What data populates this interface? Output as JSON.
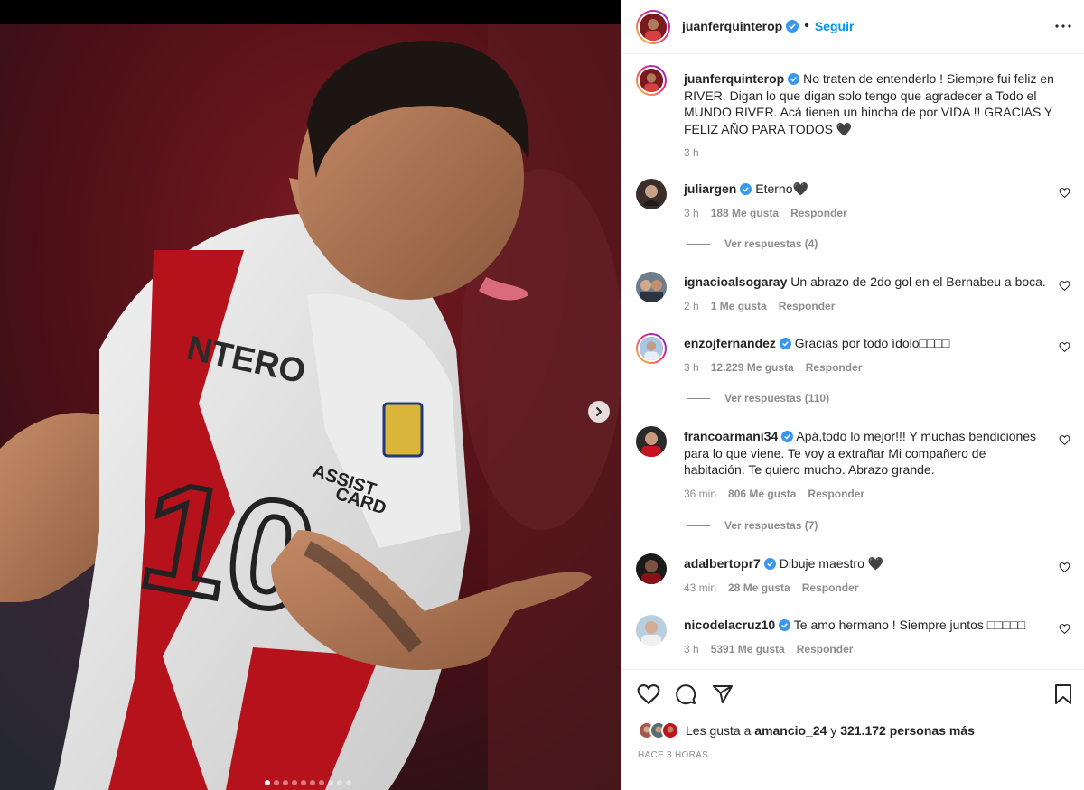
{
  "post": {
    "author": "juanferquinterop",
    "follow_label": "Seguir",
    "caption": "No traten de entenderlo ! Siempre fui feliz en RIVER. Digan lo que digan solo tengo que agradecer a Todo el MUNDO RIVER. Acá tienen un hincha de por VIDA !! GRACIAS Y FELIZ AÑO PARA TODOS 🖤",
    "caption_time": "3 h"
  },
  "media": {
    "slide_count": 10,
    "active_slide": 1,
    "next_icon": "chevron-right-icon"
  },
  "comments": [
    {
      "user": "juliargen",
      "verified": true,
      "text": "Eterno🖤",
      "time": "3 h",
      "likes": "188 Me gusta",
      "reply": "Responder",
      "replies": "Ver respuestas (4)"
    },
    {
      "user": "ignacioalsogaray",
      "verified": false,
      "text": "Un abrazo de 2do gol en el Bernabeu a boca.",
      "time": "2 h",
      "likes": "1 Me gusta",
      "reply": "Responder",
      "replies": ""
    },
    {
      "user": "enzojfernandez",
      "verified": true,
      "text": "Gracias por todo ídolo□□□□",
      "time": "3 h",
      "likes": "12.229 Me gusta",
      "reply": "Responder",
      "replies": "Ver respuestas (110)"
    },
    {
      "user": "francoarmani34",
      "verified": true,
      "text": "Apá,todo lo mejor!!! Y muchas bendiciones para lo que viene. Te voy a extrañar Mi compañero de habitación. Te quiero mucho. Abrazo grande.",
      "time": "36 min",
      "likes": "806 Me gusta",
      "reply": "Responder",
      "replies": "Ver respuestas (7)"
    },
    {
      "user": "adalbertopr7",
      "verified": true,
      "text": "Dibuje maestro 🖤",
      "time": "43 min",
      "likes": "28 Me gusta",
      "reply": "Responder",
      "replies": ""
    },
    {
      "user": "nicodelacruz10",
      "verified": true,
      "text": "Te amo hermano ! Siempre juntos □□□□□",
      "time": "3 h",
      "likes": "5391 Me gusta",
      "reply": "Responder",
      "replies": ""
    }
  ],
  "footer": {
    "likes_prefix": "Les gusta a",
    "likes_user": "amancio_24",
    "likes_middle": "y",
    "likes_count": "321.172 personas más",
    "time_ago": "HACE 3 HORAS"
  },
  "colors": {
    "accent": "#0095f6",
    "verified": "#3897f0",
    "muted": "#8e8e8e",
    "text": "#262626"
  }
}
